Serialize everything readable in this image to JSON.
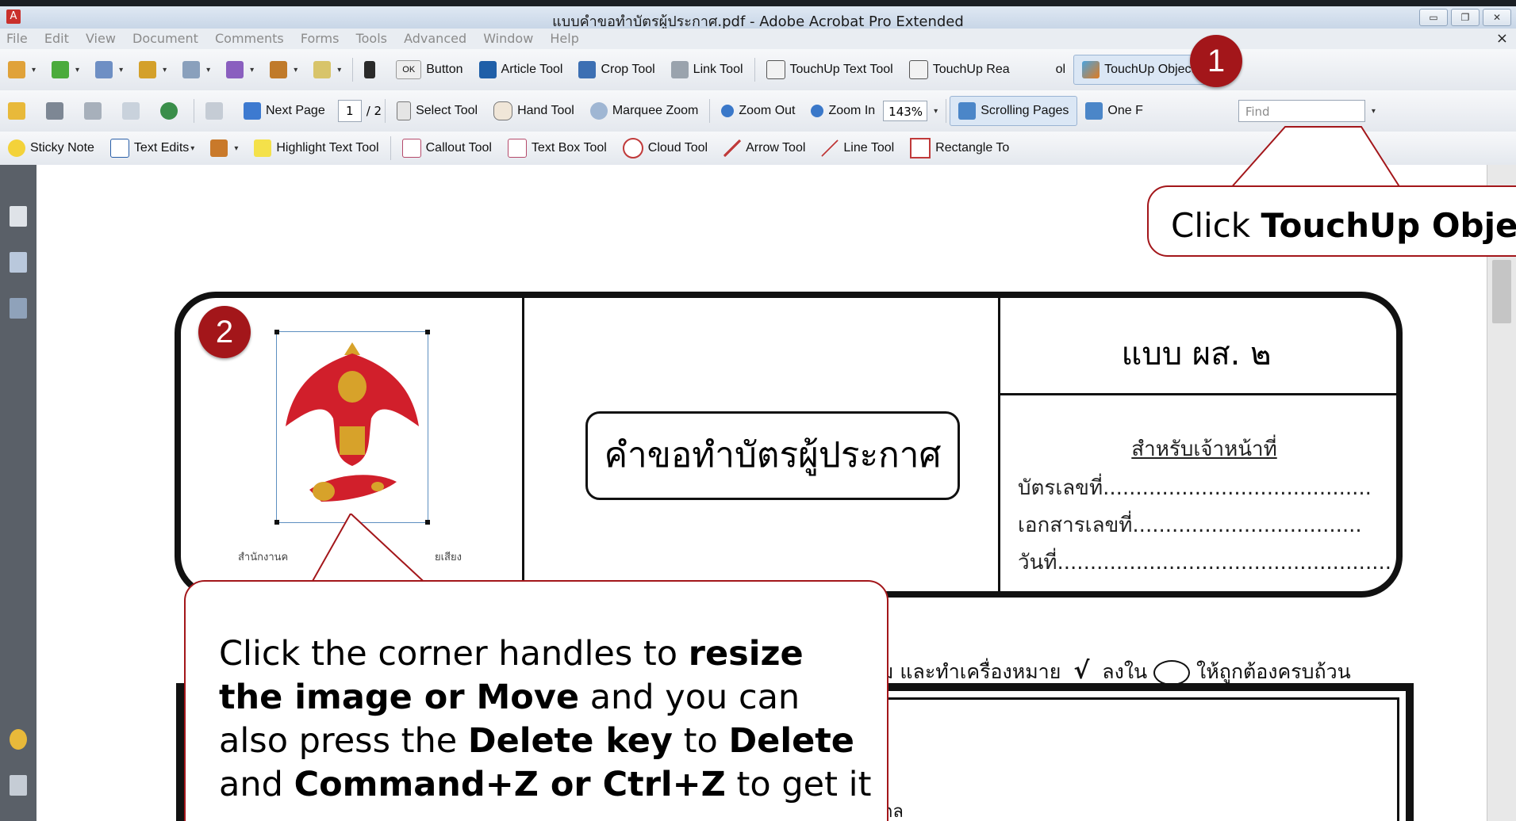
{
  "window": {
    "title": "แบบคำขอทำบัตรผู้ประกาศ.pdf - Adobe Acrobat Pro Extended",
    "close_glyph": "×"
  },
  "menu": [
    "File",
    "Edit",
    "View",
    "Document",
    "Comments",
    "Forms",
    "Tools",
    "Advanced",
    "Window",
    "Help"
  ],
  "toolbar1": {
    "button_tool": "Button",
    "button_badge": "OK",
    "article_tool": "Article Tool",
    "crop_tool": "Crop Tool",
    "link_tool": "Link Tool",
    "touchup_text": "TouchUp Text Tool",
    "touchup_reading": "TouchUp Rea",
    "touchup_reading_tail": "ol",
    "touchup_object": "TouchUp Object Tool"
  },
  "toolbar2": {
    "next_page": "Next Page",
    "page_current": "1",
    "page_total": "/ 2",
    "select_tool": "Select Tool",
    "hand_tool": "Hand Tool",
    "marquee_zoom": "Marquee Zoom",
    "zoom_out": "Zoom Out",
    "zoom_in": "Zoom In",
    "zoom_value": "143%",
    "scrolling_pages": "Scrolling Pages",
    "one_full": "One F",
    "find_placeholder": "Find"
  },
  "toolbar3": {
    "sticky_note": "Sticky Note",
    "text_edits": "Text Edits",
    "highlight": "Highlight Text Tool",
    "callout": "Callout Tool",
    "textbox": "Text Box Tool",
    "cloud": "Cloud Tool",
    "arrow": "Arrow Tool",
    "line": "Line Tool",
    "rectangle": "Rectangle To"
  },
  "document": {
    "form_title": "คำขอทำบัตรผู้ประกาศ",
    "form_code": "แบบ ผส. ๒",
    "official_header": "สำหรับเจ้าหน้าที่",
    "official_lines": [
      "บัตรเลขที่.........................................",
      "เอกสารเลขที่...................................",
      "วันที่..................................................."
    ],
    "agency_left": "สำนักงานค",
    "agency_right": "ยเสียง",
    "instruction_prefix": "ม และทำเครื่องหมาย",
    "instruction_check": "√",
    "instruction_mid": "ลงใน",
    "instruction_suffix": "ให้ถูกต้องครบถ้วน",
    "lower_fragment": "กล"
  },
  "annotations": {
    "step1_number": "1",
    "step2_number": "2",
    "step1_text_prefix": "Click ",
    "step1_text_bold": "TouchUp Obje",
    "step2_line1_a": "Click the corner handles to ",
    "step2_line1_b": "resize",
    "step2_line2_a": "the image or Move",
    "step2_line2_b": " and you can",
    "step2_line3_a": "also press the ",
    "step2_line3_b": "Delete key",
    "step2_line3_c": " to ",
    "step2_line3_d": "Delete",
    "step2_line4_a": "and ",
    "step2_line4_b": "Command+Z or Ctrl+Z",
    "step2_line4_c": " to get it"
  },
  "colors": {
    "accent_red": "#a3161a",
    "selection_blue": "#5d8fc0"
  }
}
